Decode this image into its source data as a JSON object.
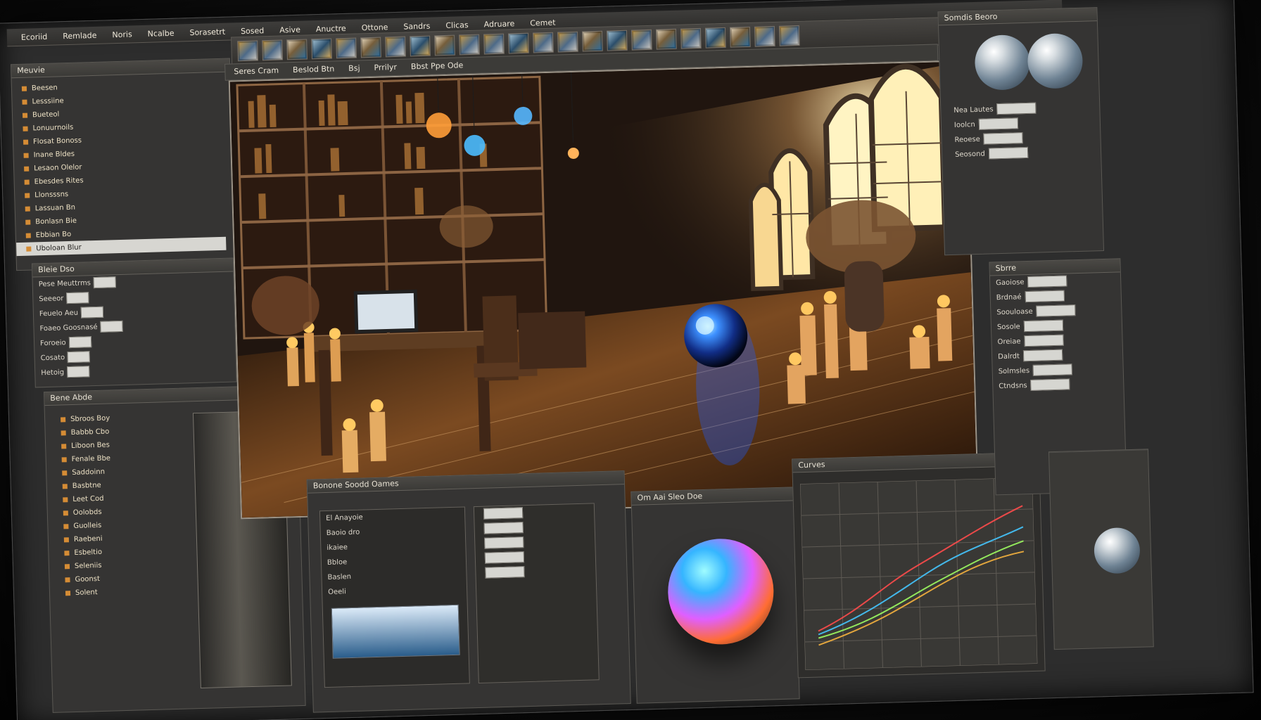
{
  "menu": {
    "items": [
      "Ecoriid",
      "Remlade",
      "Noris",
      "Ncalbe",
      "Sorasetrt",
      "Sosed",
      "Asive",
      "Anuctre",
      "Ottone",
      "Sandrs",
      "Clicas",
      "Adruare",
      "Cemet"
    ]
  },
  "toolbar": {
    "tool_names": [
      "viewport-tool",
      "image-tool",
      "render-tool",
      "brush-tool",
      "scene-tool",
      "camera-tool",
      "material-tool",
      "light-tool",
      "node-tool",
      "terrain-tool",
      "select-tool",
      "texture-tool",
      "preset-tool",
      "mask-tool",
      "sun-tool",
      "mesh-tool",
      "export-tool",
      "shader-tool",
      "particle-tool",
      "timeline-tool",
      "animation-tool",
      "layers-tool",
      "lock-tool"
    ]
  },
  "viewport": {
    "header_items": [
      "Seres Cram",
      "Beslod Btn",
      "Bsj",
      "Prrilyr",
      "Bbst Ppe Ode"
    ]
  },
  "left_panel": {
    "title": "Meuvie",
    "tree": [
      "Beesen",
      "Lesssiine",
      "Bueteol",
      "Lonuurnoils",
      "Flosat Bonoss",
      "Inane Bldes",
      "Lesaon Olelor",
      "Ebesdes Rites",
      "Llonsssns",
      "Lassuan Bn",
      "Bonlasn Bie",
      "Ebbian Bo"
    ],
    "selected": "Uboloan Blur"
  },
  "lower_left_panel": {
    "title": "Bleie Dso",
    "rows": [
      "Pese Meuttrms",
      "Seeeor",
      "Feuelo Aeu",
      "Foaeo Goosnasé",
      "Foroeio",
      "Cosato",
      "Hetoig"
    ]
  },
  "outline": {
    "title": "Bene Abde",
    "rows": [
      "Sbroos Boy",
      "Babbb Cbo",
      "Liboon Bes",
      "Fenale Bbe",
      "Saddoinn",
      "Basbtne",
      "Leet Cod",
      "Oolobds",
      "Guolleis",
      "Raebeni",
      "Esbeltio",
      "Seleniis",
      "Goonst",
      "Solent"
    ]
  },
  "materials": {
    "title": "Bonone Soodd Oames",
    "rows": [
      "El Anayoie",
      "Baoio dro",
      "ikaiee",
      "Bbloe",
      "Baslen",
      "Oeeli"
    ]
  },
  "material_preview": {
    "title": "Om Aai Sleo Doe"
  },
  "graph": {
    "title": "Curves"
  },
  "right_panel": {
    "title": "Somdis Beoro",
    "rows": [
      "Nea Lautes",
      "Ioolcn",
      "Reoese",
      "Seosond",
      "Gaoiose",
      "Brdnaé",
      "Soouloase",
      "Sosole"
    ],
    "labels": [
      "Sbrre",
      "Oreiae",
      "Dalrdt",
      "Solmsles",
      "Ctndsns"
    ]
  }
}
